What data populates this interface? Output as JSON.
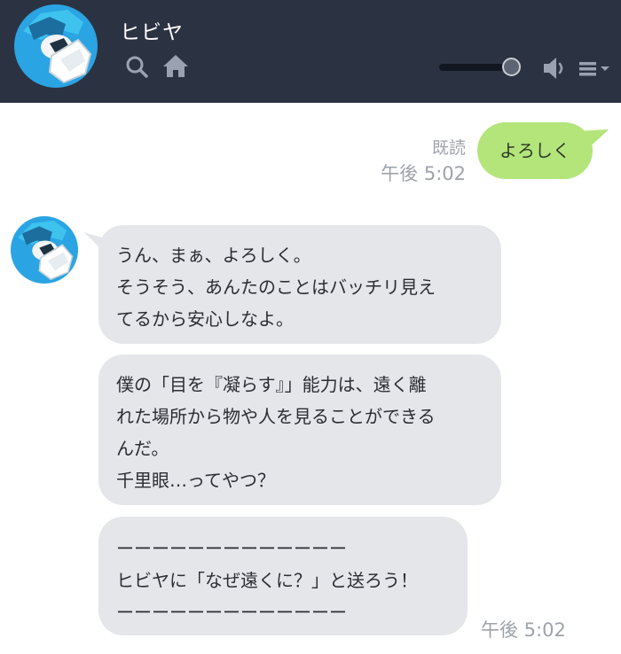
{
  "header": {
    "title": "ヒビヤ",
    "avatar_icon": "character-avatar-icon",
    "search_icon": "search-icon",
    "home_icon": "home-icon",
    "volume_icon": "speaker-icon",
    "menu_icon": "menu-icon",
    "volume_level": 0.82
  },
  "messages": [
    {
      "side": "sent",
      "text": "よろしく",
      "read_status": "既読",
      "time": "午後 5:02"
    },
    {
      "side": "received",
      "bubbles": [
        "うん、まぁ、よろしく。\nそうそう、あんたのことはバッチリ見え\nてるから安心しなよ。",
        "僕の「目を『凝らす』」能力は、遠く離\nれた場所から物や人を見ることができる\nんだ。\n千里眼…ってやつ？",
        "ーーーーーーーーーーーーー\nヒビヤに「なぜ遠くに？」と送ろう！\nーーーーーーーーーーーーー"
      ],
      "time": "午後 5:02"
    }
  ],
  "colors": {
    "header_bg": "#2b3242",
    "sent_bubble": "#b3e57b",
    "received_bubble": "#e4e6ea",
    "meta_text": "#9ea3aa"
  }
}
